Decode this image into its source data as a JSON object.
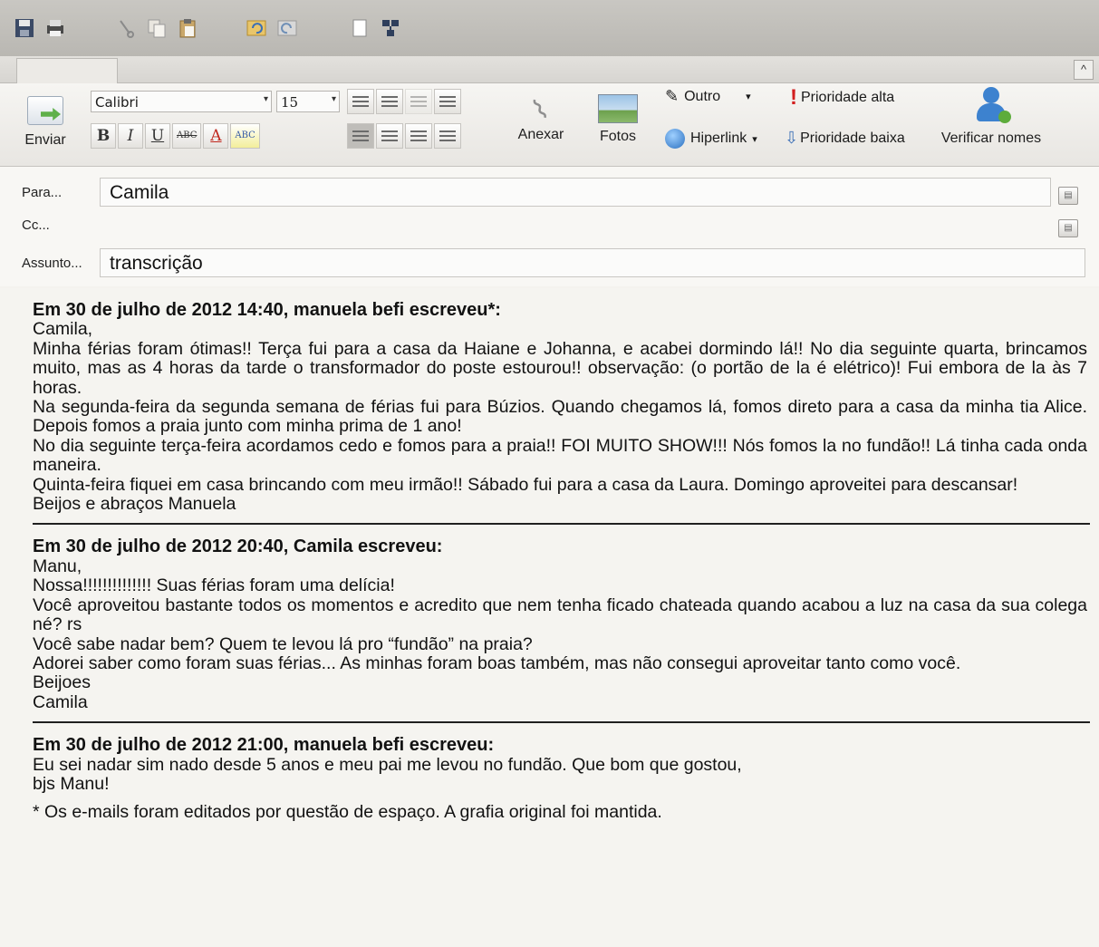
{
  "ribbon": {
    "send": "Enviar",
    "font": "Calibri",
    "size": "15",
    "bold": "B",
    "italic": "I",
    "underline": "U",
    "strike": "ABC",
    "font_color": "A",
    "highlight": "ABC",
    "attach": "Anexar",
    "photos": "Fotos",
    "other": "Outro",
    "hyperlink": "Hiperlink",
    "priority_high": "Prioridade alta",
    "priority_low": "Prioridade baixa",
    "check_names": "Verificar nomes"
  },
  "fields": {
    "to_label": "Para...",
    "to_value": "Camila",
    "cc_label": "Cc...",
    "cc_value": "",
    "subject_label": "Assunto...",
    "subject_value": "transcrição"
  },
  "messages": [
    {
      "header": "Em 30 de julho de 2012 14:40, manuela befi escreveu*:",
      "lines": [
        "Camila,",
        "Minha férias foram ótimas!! Terça fui para a casa da Haiane e Johanna, e acabei dormindo lá!! No dia seguinte quarta, brincamos muito, mas as 4 horas da tarde o transformador do poste estourou!! observação: (o portão de la é elétrico)! Fui embora de la às 7 horas.",
        "Na segunda-feira da segunda semana de férias fui para Búzios. Quando chegamos lá, fomos direto para a casa da minha tia Alice. Depois fomos a praia junto com minha prima de 1 ano!",
        "No dia seguinte terça-feira acordamos cedo e fomos para a praia!! FOI MUITO SHOW!!! Nós fomos la no fundão!! Lá tinha cada onda maneira.",
        "Quinta-feira fiquei em casa brincando com meu irmão!! Sábado fui para a casa da Laura. Domingo aproveitei para descansar!",
        "Beijos e abraços Manuela"
      ]
    },
    {
      "header": "Em 30 de julho de 2012 20:40, Camila escreveu:",
      "lines": [
        "Manu,",
        "Nossa!!!!!!!!!!!!!! Suas férias foram uma delícia!",
        "Você aproveitou bastante todos os momentos e acredito que nem tenha ficado chateada quando acabou a luz na casa da sua colega né? rs",
        "Você sabe nadar bem? Quem te levou lá pro “fundão” na praia?",
        "Adorei saber como foram suas férias... As minhas foram boas também, mas não consegui aproveitar tanto como você.",
        "Beijoes",
        "Camila"
      ]
    },
    {
      "header": "Em 30 de julho de 2012 21:00, manuela befi escreveu:",
      "lines": [
        "Eu sei nadar sim nado desde 5 anos e meu pai me levou no fundão. Que bom que gostou,",
        "bjs Manu!"
      ]
    }
  ],
  "footnote": "* Os e-mails foram editados por questão de espaço. A grafia original foi mantida."
}
